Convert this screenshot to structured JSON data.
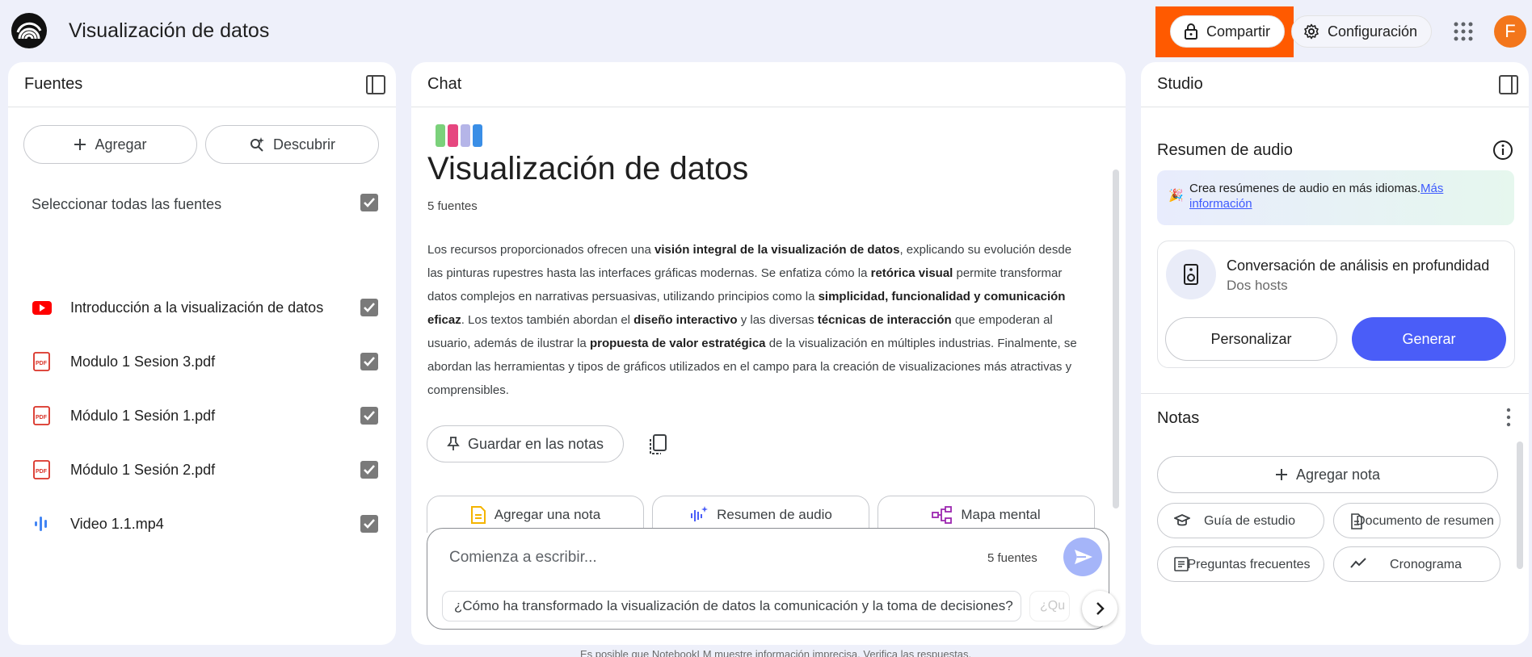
{
  "header": {
    "title": "Visualización de datos",
    "share_label": "Compartir",
    "settings_label": "Configuración",
    "avatar_initial": "F"
  },
  "sources": {
    "title": "Fuentes",
    "add_label": "Agregar",
    "discover_label": "Descubrir",
    "select_all_label": "Seleccionar todas las fuentes",
    "items": [
      {
        "label": "Introducción a la visualización de datos",
        "type": "youtube-icon"
      },
      {
        "label": "Modulo 1 Sesion 3.pdf",
        "type": "pdf-icon"
      },
      {
        "label": "Módulo 1 Sesión 1.pdf",
        "type": "pdf-icon"
      },
      {
        "label": "Módulo 1 Sesión 2.pdf",
        "type": "pdf-icon"
      },
      {
        "label": "Video 1.1.mp4",
        "type": "audio-wave-icon"
      }
    ]
  },
  "chat": {
    "title": "Chat",
    "notebook_title": "Visualización de datos",
    "source_count": "5 fuentes",
    "summary": {
      "p1": "Los recursos proporcionados ofrecen una ",
      "b1": "visión integral de la visualización de datos",
      "p2": ", explicando su evolución desde las pinturas rupestres hasta las interfaces gráficas modernas. Se enfatiza cómo la ",
      "b2": "retórica visual",
      "p3": " permite transformar datos complejos en narrativas persuasivas, utilizando principios como la ",
      "b3": "simplicidad, funcionalidad y comunicación eficaz",
      "p4": ". Los textos también abordan el ",
      "b4": "diseño interactivo",
      "p5": " y las diversas ",
      "b5": "técnicas de interacción",
      "p6": " que empoderan al usuario, además de ilustrar la ",
      "b6": "propuesta de valor estratégica",
      "p7": " de la visualización en múltiples industrias. Finalmente, se abordan las herramientas y tipos de gráficos utilizados en el campo para la creación de visualizaciones más atractivas y comprensibles."
    },
    "save_note_label": "Guardar en las notas",
    "suggestions": [
      "Agregar una nota",
      "Resumen de audio",
      "Mapa mental"
    ],
    "composer": {
      "placeholder": "Comienza a escribir...",
      "count": "5 fuentes",
      "suggested_question": "¿Cómo ha transformado la visualización de datos la comunicación y la toma de decisiones?",
      "suggested_question_2": "¿Qu"
    },
    "disclaimer": "Es posible que NotebookLM muestre información imprecisa. Verifica las respuestas."
  },
  "studio": {
    "title": "Studio",
    "audio_title": "Resumen de audio",
    "banner_text": "Crea resúmenes de audio en más idiomas.",
    "banner_link": "Más información",
    "conversation_title": "Conversación de análisis en profundidad",
    "conversation_sub": "Dos hosts",
    "customize_label": "Personalizar",
    "generate_label": "Generar",
    "notes_title": "Notas",
    "add_note_label": "Agregar nota",
    "note_actions": [
      "Guía de estudio",
      "Documento de resumen",
      "Preguntas frecuentes",
      "Cronograma"
    ]
  },
  "colors": {
    "accent": "#4a5df8",
    "highlight": "#ff5a00",
    "avatar": "#f3761b",
    "background": "#eef0fa"
  }
}
